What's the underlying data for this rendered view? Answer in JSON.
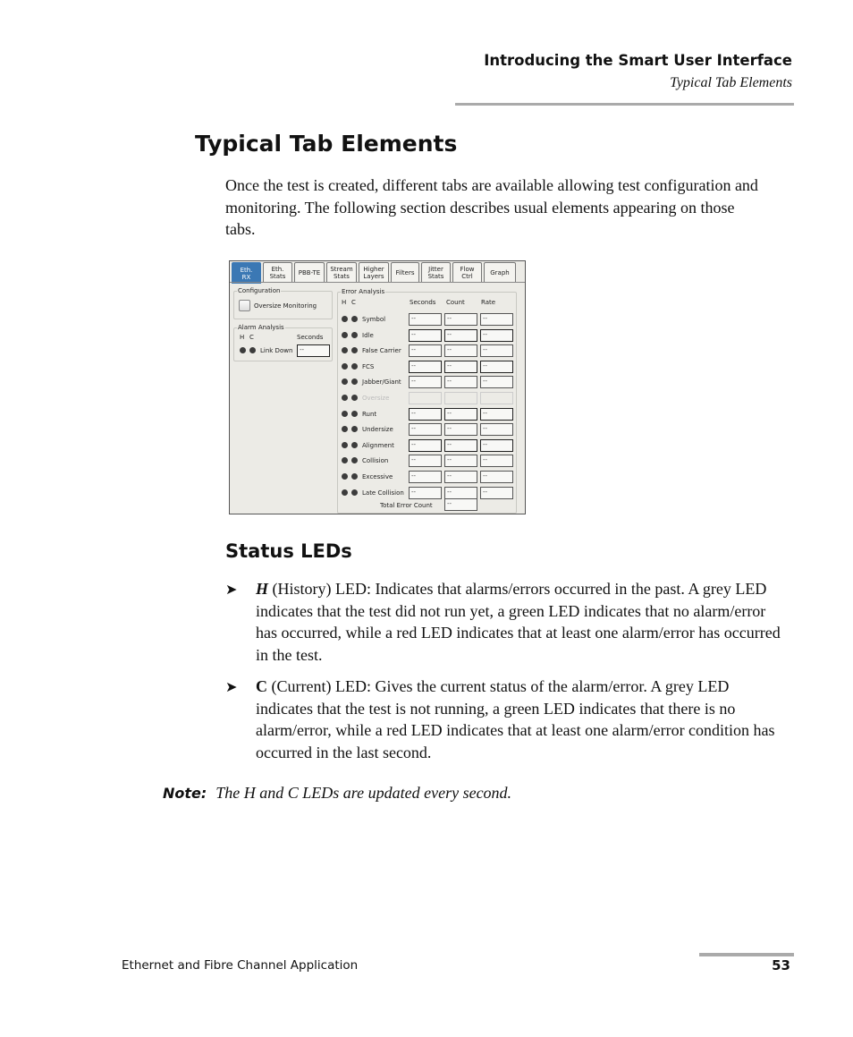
{
  "header": {
    "chapter_title": "Introducing the Smart User Interface",
    "section_title": "Typical Tab Elements"
  },
  "page_title": "Typical Tab Elements",
  "intro_text": "Once the test is created, different tabs are available allowing test configuration and monitoring. The following section describes usual elements appearing on those tabs.",
  "ui_screenshot": {
    "tabs": [
      {
        "line1": "Eth.",
        "line2": "RX",
        "active": true
      },
      {
        "line1": "Eth.",
        "line2": "Stats",
        "active": false
      },
      {
        "line1": "PBB-TE",
        "line2": "",
        "active": false
      },
      {
        "line1": "Stream",
        "line2": "Stats",
        "active": false
      },
      {
        "line1": "Higher",
        "line2": "Layers",
        "active": false
      },
      {
        "line1": "Filters",
        "line2": "",
        "active": false
      },
      {
        "line1": "Jitter",
        "line2": "Stats",
        "active": false
      },
      {
        "line1": "Flow",
        "line2": "Ctrl",
        "active": false
      },
      {
        "line1": "Graph",
        "line2": "",
        "active": false
      }
    ],
    "configuration": {
      "title": "Configuration",
      "oversize_monitoring_label": "Oversize Monitoring",
      "oversize_monitoring_checked": false
    },
    "alarm_analysis": {
      "title": "Alarm Analysis",
      "h_label": "H",
      "c_label": "C",
      "seconds_label": "Seconds",
      "rows": [
        {
          "label": "Link Down",
          "seconds": "--"
        }
      ]
    },
    "error_analysis": {
      "title": "Error Analysis",
      "h_label": "H",
      "c_label": "C",
      "col_seconds": "Seconds",
      "col_count": "Count",
      "col_rate": "Rate",
      "rows": [
        {
          "label": "Symbol",
          "seconds": "--",
          "count": "--",
          "rate": "--",
          "enabled": true
        },
        {
          "label": "Idle",
          "seconds": "--",
          "count": "--",
          "rate": "--",
          "enabled": true
        },
        {
          "label": "False Carrier",
          "seconds": "--",
          "count": "--",
          "rate": "--",
          "enabled": true
        },
        {
          "label": "FCS",
          "seconds": "--",
          "count": "--",
          "rate": "--",
          "enabled": true
        },
        {
          "label": "Jabber/Giant",
          "seconds": "--",
          "count": "--",
          "rate": "--",
          "enabled": true
        },
        {
          "label": "Oversize",
          "seconds": "",
          "count": "",
          "rate": "",
          "enabled": false
        },
        {
          "label": "Runt",
          "seconds": "--",
          "count": "--",
          "rate": "--",
          "enabled": true
        },
        {
          "label": "Undersize",
          "seconds": "--",
          "count": "--",
          "rate": "--",
          "enabled": true
        },
        {
          "label": "Alignment",
          "seconds": "--",
          "count": "--",
          "rate": "--",
          "enabled": true
        },
        {
          "label": "Collision",
          "seconds": "--",
          "count": "--",
          "rate": "--",
          "enabled": true
        },
        {
          "label": "Excessive",
          "seconds": "--",
          "count": "--",
          "rate": "--",
          "enabled": true
        },
        {
          "label": "Late Collision",
          "seconds": "--",
          "count": "--",
          "rate": "--",
          "enabled": true
        }
      ],
      "total_label": "Total Error Count",
      "total_value": "--"
    },
    "colors": {
      "active_tab": "#3b78b4",
      "led": "#3c3c3c"
    }
  },
  "status_leds": {
    "heading": "Status LEDs",
    "bullet_glyph": "➤",
    "items": [
      {
        "key": "H",
        "text": " (History) LED: Indicates that alarms/errors occurred in the past. A grey LED indicates that the test did not run yet, a green LED indicates that no alarm/error has occurred, while a red LED indicates that at least one alarm/error has occurred in the test."
      },
      {
        "key": "C",
        "text": " (Current) LED: Gives the current status of the alarm/error. A grey LED indicates that the test is not running, a green LED indicates that there is no alarm/error, while a red LED indicates that at least one alarm/error condition has occurred in the last second."
      }
    ]
  },
  "note": {
    "label": "Note:",
    "text": "The H and C LEDs are updated every second."
  },
  "footer": {
    "doc_title": "Ethernet and Fibre Channel Application",
    "page_number": "53"
  }
}
